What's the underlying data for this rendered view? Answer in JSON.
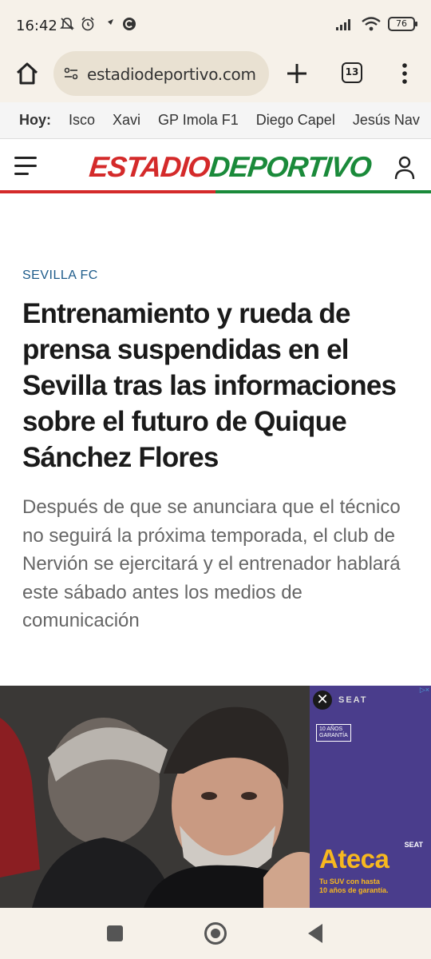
{
  "status_bar": {
    "time": "16:42",
    "battery": "76",
    "icons": [
      "notifications-off-icon",
      "alarm-icon",
      "tools-icon",
      "copyright-icon",
      "signal-icon",
      "wifi-icon",
      "battery-icon"
    ]
  },
  "browser": {
    "url": "estadiodeportivo.com",
    "tab_count": "13"
  },
  "trending": {
    "label": "Hoy:",
    "items": [
      "Isco",
      "Xavi",
      "GP Imola F1",
      "Diego Capel",
      "Jesús Nav"
    ]
  },
  "site": {
    "logo_part1": "ESTADIO",
    "logo_part2": "DEPORTIVO",
    "colors": {
      "red": "#d42a2a",
      "green": "#1a8a3a",
      "section": "#1d5b8a"
    }
  },
  "article": {
    "section": "SEVILLA FC",
    "headline": "Entrenamiento y rueda de prensa suspendidas en el Sevilla tras las informaciones sobre el futuro de Quique Sánchez Flores",
    "subheadline": "Después de que se anunciara que el técnico no seguirá la próxima temporada, el club de Nervión se ejercitará y el entrenador hablará este sábado antes los medios de comunicación"
  },
  "ad": {
    "close": "✕",
    "brand": "SEAT",
    "badge_line1": "10 AÑOS",
    "badge_line2": "GARANTÍA",
    "model": "Ateca",
    "brand_small": "SEAT",
    "copy_line1": "Tu SUV con hasta",
    "copy_line2": "10 años de garantía.",
    "choice": "▷×"
  }
}
